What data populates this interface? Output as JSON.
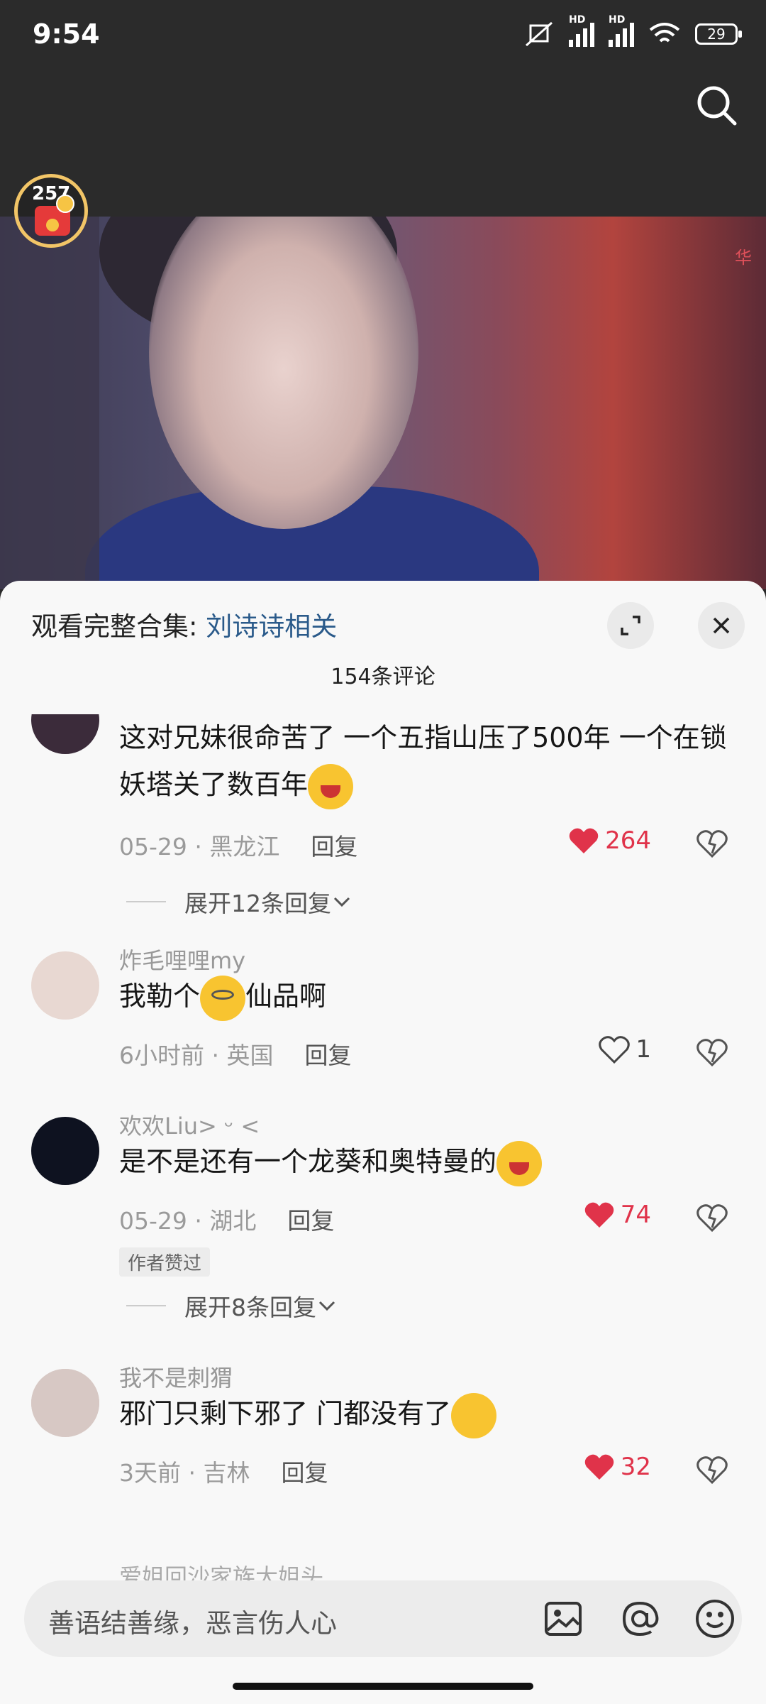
{
  "status_bar": {
    "time": "9:54",
    "signal1": "HD",
    "signal2": "HD",
    "battery": "29"
  },
  "video": {
    "watermark": "华",
    "red_packet_count": "257"
  },
  "panel": {
    "collection_prefix": "观看完整合集: ",
    "collection_name": "刘诗诗相关",
    "comment_count": "154条评论"
  },
  "comments": [
    {
      "text": "这对兄妹很命苦了 一个五指山压了500年 一个在锁妖塔关了数百年",
      "emoji": "cry",
      "date": "05-29",
      "location": "黑龙江",
      "reply": "回复",
      "likes": "264",
      "liked": true,
      "expand": "展开12条回复"
    },
    {
      "username": "炸毛哩哩my",
      "text_before": "我勒个",
      "emoji": "dizzy",
      "text_after": "仙品啊",
      "date": "6小时前",
      "location": "英国",
      "reply": "回复",
      "likes": "1",
      "liked": false
    },
    {
      "username": "欢欢Liu> ᵕ <",
      "text": "是不是还有一个龙葵和奥特曼的",
      "emoji": "cry",
      "date": "05-29",
      "location": "湖北",
      "reply": "回复",
      "likes": "74",
      "liked": true,
      "badge": "作者赞过",
      "expand": "展开8条回复"
    },
    {
      "username": "我不是刺猬",
      "text": "邪门只剩下邪了 门都没有了",
      "emoji": "smile",
      "date": "3天前",
      "location": "吉林",
      "reply": "回复",
      "likes": "32",
      "liked": true
    }
  ],
  "next_username_peek": "爱姐回沙家族大姐头",
  "input": {
    "placeholder": "善语结善缘，恶言伤人心"
  },
  "colors": {
    "accent": "#e0334a",
    "link": "#2a5a8a"
  }
}
